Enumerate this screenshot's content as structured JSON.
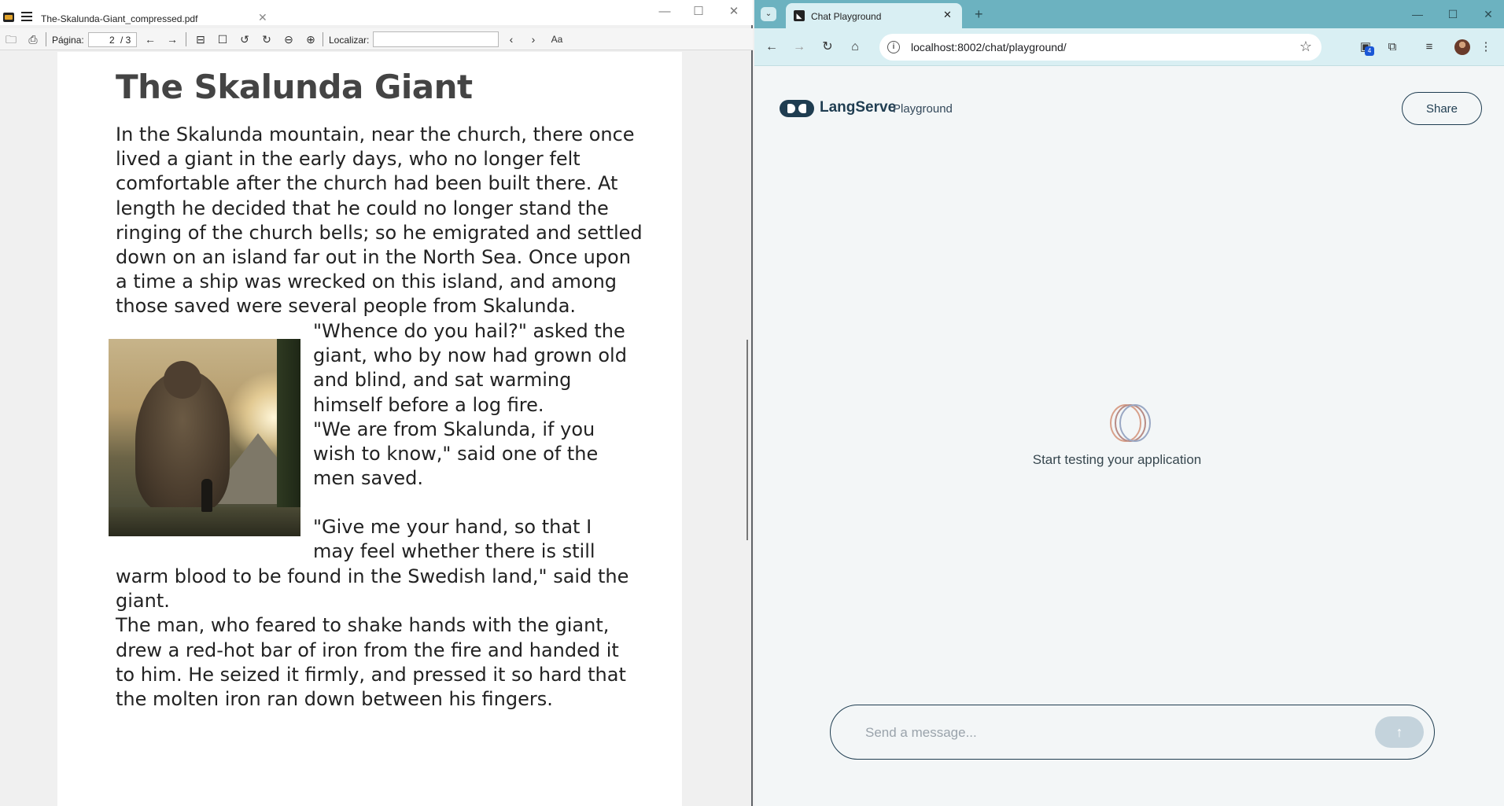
{
  "pdf_viewer": {
    "tab_title": "The-Skalunda-Giant_compressed.pdf",
    "page_label": "Página:",
    "page_current": "2",
    "page_total": "/ 3",
    "find_label": "Localizar:",
    "document": {
      "heading": "The Skalunda Giant",
      "para1": [
        "In the Skalunda mountain, near the church, there once",
        "lived a giant in the early days, who no longer felt",
        "comfortable after the church had been built there. At",
        "length he decided that he could no longer stand the",
        "ringing of the church bells; so he emigrated and settled",
        "down on an island far out in the North Sea. Once upon",
        "a time a ship was wrecked on this island, and among",
        "those saved were several people from Skalunda."
      ],
      "para2": [
        "\"Whence do you hail?\" asked the",
        "giant, who by now had grown old",
        "and blind, and sat warming",
        "himself before a log fire.",
        "\"We are from Skalunda, if you",
        "wish to know,\" said one of the",
        "men saved."
      ],
      "para3a": [
        "\"Give me your hand, so that I",
        "may feel whether there is still"
      ],
      "para3b": [
        "warm blood to be found in the Swedish land,\" said the",
        "giant.",
        "The man, who feared to shake hands with the giant,",
        "drew a red-hot bar of iron from the fire and handed it",
        "to him. He seized it firmly, and pressed it so hard that",
        "the molten iron ran down between his fingers."
      ]
    }
  },
  "browser": {
    "tab_title": "Chat Playground",
    "url": "localhost:8002/chat/playground/",
    "extension_badge": "4",
    "app": {
      "name": "LangServe",
      "subtitle": "Playground",
      "share_label": "Share",
      "empty_text": "Start testing your application",
      "message_placeholder": "Send a message..."
    }
  }
}
